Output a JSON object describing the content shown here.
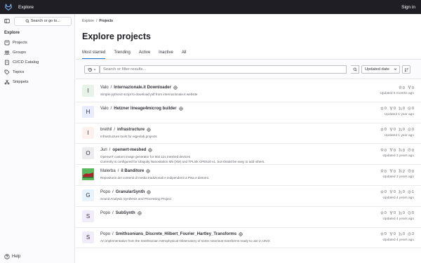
{
  "topbar": {
    "title": "Explore",
    "signin": "Sign in"
  },
  "sidebar": {
    "search_label": "Search or go to...",
    "heading": "Explore",
    "items": [
      {
        "label": "Projects",
        "icon": "project-icon"
      },
      {
        "label": "Groups",
        "icon": "group-icon"
      },
      {
        "label": "CI/CD Catalog",
        "icon": "catalog-icon"
      },
      {
        "label": "Topics",
        "icon": "label-icon"
      },
      {
        "label": "Snippets",
        "icon": "snippet-icon"
      }
    ],
    "help": "Help"
  },
  "breadcrumb": {
    "root": "Explore",
    "sep": "/",
    "current": "Projects"
  },
  "page_title": "Explore projects",
  "tabs": [
    "Most starred",
    "Trending",
    "Active",
    "Inactive",
    "All"
  ],
  "filter": {
    "placeholder": "Search or filter results...",
    "sort_label": "Updated date"
  },
  "projects": [
    {
      "avatar": "I",
      "avatar_bg": "#e7f3e9",
      "namespace": "Valo",
      "name": "Internazionale.it Downloader",
      "desc": [
        "Simple python3 script to download pdf from internazionale.it website"
      ],
      "stars": "0",
      "forks": "0",
      "mrs": "",
      "issues": "",
      "updated": "Updated 5 months ago"
    },
    {
      "avatar": "H",
      "avatar_bg": "#e9ebff",
      "namespace": "Valo",
      "name": "Hetzner lineage4microg builder",
      "desc": [],
      "stars": "0",
      "forks": "0",
      "mrs": "0",
      "issues": "0",
      "updated": "Updated 1 year ago"
    },
    {
      "avatar": "I",
      "avatar_bg": "#fcf1ef",
      "namespace": "brethil",
      "name": "infrastructure",
      "desc": [
        "Infrastructure tools for eigenlab projects"
      ],
      "stars": "0",
      "forks": "0",
      "mrs": "0",
      "issues": "0",
      "updated": "Updated 1 year ago"
    },
    {
      "avatar": "O",
      "avatar_bg": "#ececef",
      "namespace": "Juri",
      "name": "openwrt-meshed",
      "desc": [
        "OpenwrT custom image generator for 802.11s meshed devices",
        "Currently is configured for Ubiquity Nanostation M5 (XM) and TPLink CPE510 v1, but should be easy to add others."
      ],
      "stars": "0",
      "forks": "0",
      "mrs": "0",
      "issues": "0",
      "updated": "Updated 3 years ago"
    },
    {
      "avatar": "",
      "avatar_bg": "#5cb85c",
      "namespace": "Malerba",
      "name": "il Banditore",
      "desc": [
        "Repositorio dei contenti di media tradizionali e indipendenti a Pisa e dintorni."
      ],
      "stars": "0",
      "forks": "0",
      "mrs": "2",
      "issues": "0",
      "updated": "Updated 3 years ago"
    },
    {
      "avatar": "G",
      "avatar_bg": "#e9f3fc",
      "namespace": "Popo",
      "name": "GranularSynth",
      "desc": [
        "Sound Analysis Synthesis and Processing Project"
      ],
      "stars": "0",
      "forks": "0",
      "mrs": "0",
      "issues": "1",
      "updated": "Updated 4 years ago"
    },
    {
      "avatar": "S",
      "avatar_bg": "#f1ecf9",
      "namespace": "Popo",
      "name": "SubSynth",
      "desc": [],
      "stars": "0",
      "forks": "0",
      "mrs": "0",
      "issues": "0",
      "updated": "Updated 4 years ago"
    },
    {
      "avatar": "S",
      "avatar_bg": "#f1ecf9",
      "namespace": "Popo",
      "name": "Smithsonians_Discrete_Hilbert_Fourier_Hartley_Transforms",
      "desc": [
        "An implementation from the Smithsonian Astrophysical Observatory of some notorious transforms ready to use in UNIX"
      ],
      "stars": "0",
      "forks": "0",
      "mrs": "0",
      "issues": "2",
      "updated": "Updated 4 years ago"
    }
  ]
}
